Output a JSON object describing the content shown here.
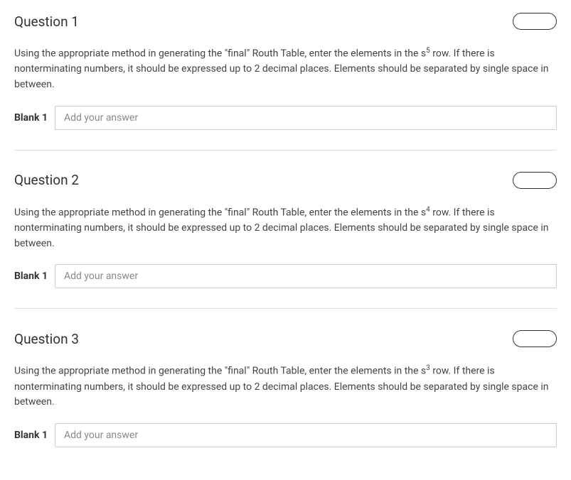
{
  "questions": [
    {
      "title": "Question 1",
      "text_before_sup": "Using the appropriate method in generating the \"final\" Routh Table, enter the elements in the s",
      "sup": "5",
      "text_after_sup": " row. If there is nonterminating numbers, it should be expressed up to 2 decimal places. Elements should be separated by single space in between.",
      "blank_label": "Blank 1",
      "placeholder": "Add your answer"
    },
    {
      "title": "Question 2",
      "text_before_sup": "Using the appropriate method in generating the \"final\" Routh Table, enter the elements in the s",
      "sup": "4",
      "text_after_sup": " row. If there is nonterminating numbers, it should be expressed up to 2 decimal places. Elements should be separated by single space in between.",
      "blank_label": "Blank 1",
      "placeholder": "Add your answer"
    },
    {
      "title": "Question 3",
      "text_before_sup": "Using the appropriate method in generating the \"final\" Routh Table, enter the elements in the s",
      "sup": "3",
      "text_after_sup": " row. If there is nonterminating numbers, it should be expressed up to 2 decimal places. Elements should be separated by single space in between.",
      "blank_label": "Blank 1",
      "placeholder": "Add your answer"
    }
  ]
}
